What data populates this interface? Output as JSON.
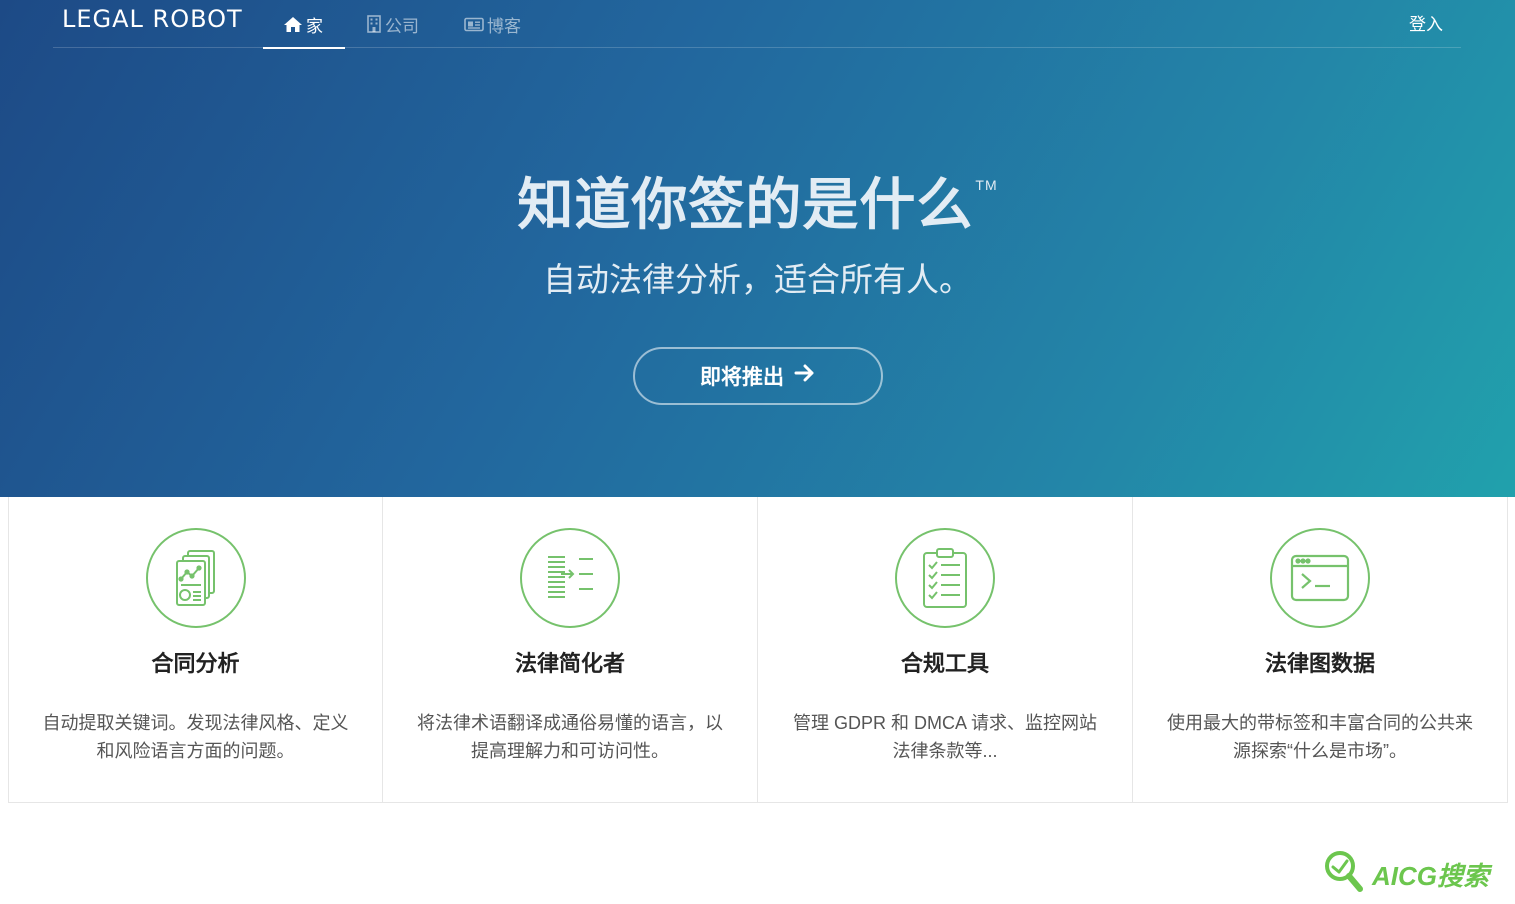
{
  "navbar": {
    "brand": "LEGAL ROBOT",
    "items": [
      {
        "label": "家",
        "icon": "home-icon",
        "active": true
      },
      {
        "label": "公司",
        "icon": "building-icon",
        "active": false
      },
      {
        "label": "博客",
        "icon": "newspaper-icon",
        "active": false
      }
    ],
    "login_label": "登入"
  },
  "hero": {
    "title": "知道你签的是什么",
    "trademark": "TM",
    "subtitle": "自动法律分析，适合所有人。",
    "cta_label": "即将推出",
    "cta_icon": "arrow-right-icon"
  },
  "features": [
    {
      "title": "合同分析",
      "description": "自动提取关键词。发现法律风格、定义和风险语言方面的问题。",
      "icon": "contract-analysis-icon"
    },
    {
      "title": "法律简化者",
      "description": "将法律术语翻译成通俗易懂的语言，以提高理解力和可访问性。",
      "icon": "simplify-text-icon"
    },
    {
      "title": "合规工具",
      "description": "管理 GDPR 和 DMCA 请求、监控网站法律条款等...",
      "icon": "clipboard-checklist-icon"
    },
    {
      "title": "法律图数据",
      "description": "使用最大的带标签和丰富合同的公共来源探索“什么是市场”。",
      "icon": "terminal-window-icon"
    }
  ],
  "watermark": {
    "text": "AICG搜索",
    "icon": "magnifier-icon"
  },
  "colors": {
    "accent_green": "#76c26c",
    "hero_start": "#1d4a86",
    "hero_end": "#21a1ac"
  }
}
